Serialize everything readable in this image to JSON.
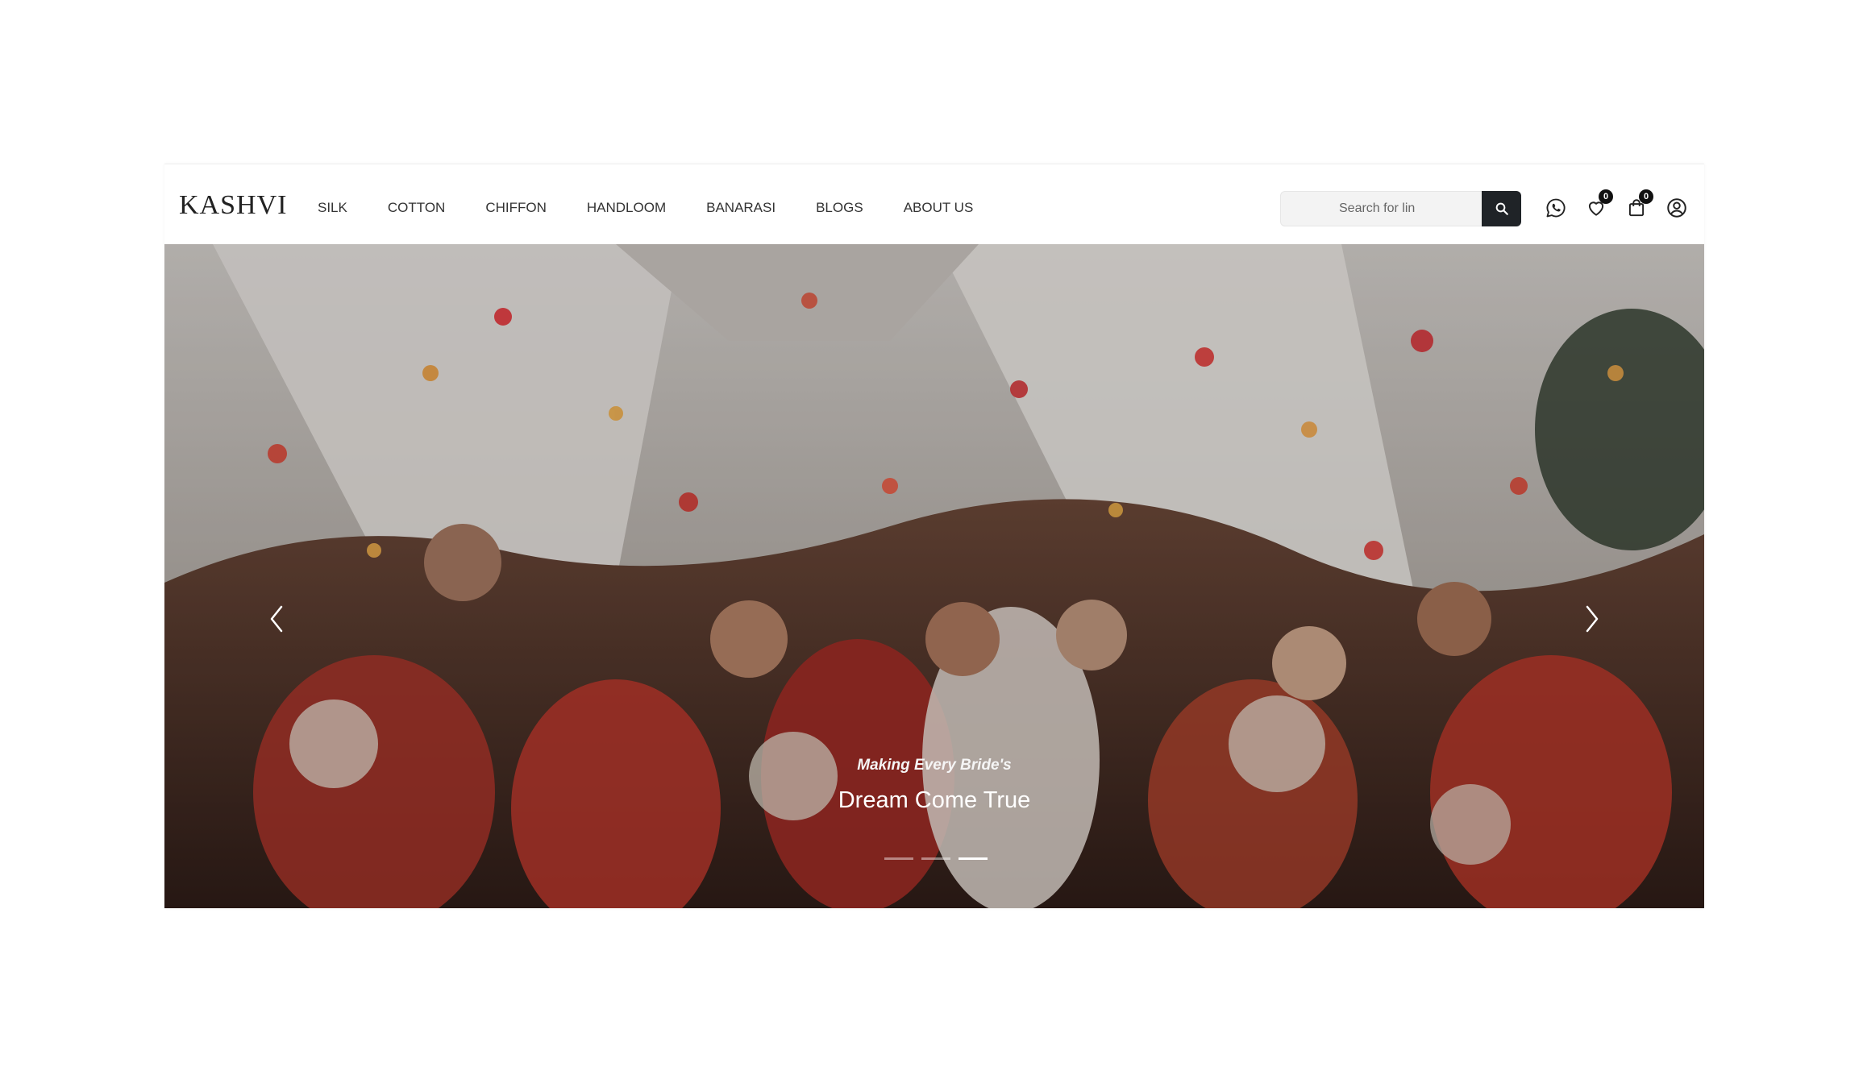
{
  "brand": {
    "logo_text": "KASHVI"
  },
  "nav": {
    "items": [
      {
        "label": "SILK"
      },
      {
        "label": "COTTON"
      },
      {
        "label": "CHIFFON"
      },
      {
        "label": "HANDLOOM"
      },
      {
        "label": "BANARASI"
      },
      {
        "label": "BLOGS"
      },
      {
        "label": "ABOUT US"
      }
    ]
  },
  "search": {
    "placeholder": "Search for lin",
    "icon": "search-icon"
  },
  "header_icons": {
    "whatsapp": {
      "icon": "whatsapp-icon"
    },
    "wishlist": {
      "icon": "heart-icon",
      "count": "0"
    },
    "cart": {
      "icon": "shopping-bag-icon",
      "count": "0"
    },
    "account": {
      "icon": "user-circle-icon"
    }
  },
  "hero": {
    "subtitle": "Making Every Bride's",
    "title": "Dream Come True",
    "slides_total": 3,
    "active_slide": 3
  },
  "colors": {
    "search_button": "#1f2327",
    "badge": "#111111",
    "text": "#333333"
  }
}
